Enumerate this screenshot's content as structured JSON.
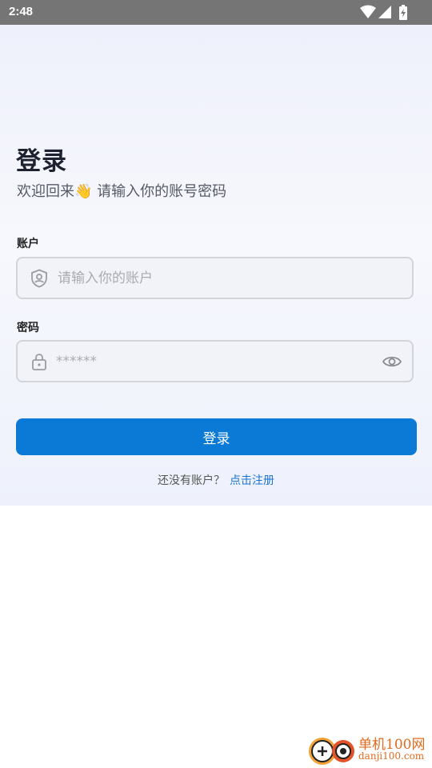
{
  "status_bar": {
    "time": "2:48"
  },
  "header": {
    "title": "登录",
    "subtitle_before": "欢迎回来",
    "subtitle_emoji": "👋",
    "subtitle_after": " 请输入你的账号密码"
  },
  "account": {
    "label": "账户",
    "placeholder": "请输入你的账户",
    "value": ""
  },
  "password": {
    "label": "密码",
    "placeholder": "******",
    "value": ""
  },
  "login_button": {
    "label": "登录"
  },
  "register": {
    "prompt": "还没有账户？",
    "link": "点击注册"
  },
  "watermark": {
    "line1": "单机100网",
    "line2": "danji100.com"
  },
  "colors": {
    "primary": "#0a7ad6",
    "link": "#1a73d6",
    "status_bar": "#757575"
  }
}
